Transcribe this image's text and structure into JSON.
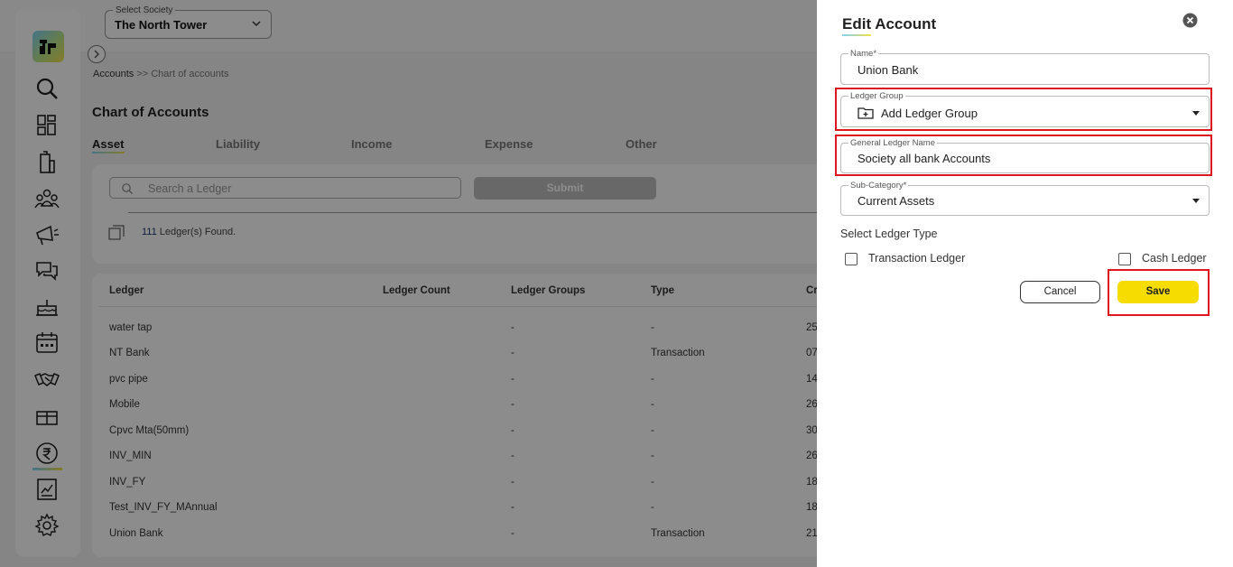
{
  "header": {
    "society_label": "Select Society",
    "society_value": "The North Tower"
  },
  "sidebar": {
    "icons": [
      "search-icon",
      "dashboard-icon",
      "building-icon",
      "people-icon",
      "megaphone-icon",
      "chat-icon",
      "cake-icon",
      "calendar-icon",
      "handshake-icon",
      "gift-icon",
      "rupee-icon",
      "report-icon",
      "gear-icon"
    ],
    "active": "rupee-icon"
  },
  "breadcrumb": {
    "root": "Accounts",
    "separator": ">>",
    "current": "Chart of accounts"
  },
  "page": {
    "title": "Chart of Accounts"
  },
  "tabs": [
    "Asset",
    "Liability",
    "Income",
    "Expense",
    "Other"
  ],
  "filters": {
    "search_placeholder": "Search a Ledger",
    "submit_label": "Submit",
    "found_count": "111",
    "found_suffix": "Ledger(s) Found."
  },
  "table": {
    "columns": [
      "Ledger",
      "Ledger Count",
      "Ledger Groups",
      "Type",
      "Cr"
    ],
    "rows": [
      {
        "ledger": "water tap",
        "count": "",
        "groups": "-",
        "type": "-",
        "cr": "25"
      },
      {
        "ledger": "NT Bank",
        "count": "",
        "groups": "-",
        "type": "Transaction",
        "cr": "07"
      },
      {
        "ledger": "pvc pipe",
        "count": "",
        "groups": "-",
        "type": "-",
        "cr": "14"
      },
      {
        "ledger": "Mobile",
        "count": "",
        "groups": "-",
        "type": "-",
        "cr": "26"
      },
      {
        "ledger": "Cpvc Mta(50mm)",
        "count": "",
        "groups": "-",
        "type": "-",
        "cr": "30"
      },
      {
        "ledger": "INV_MIN",
        "count": "",
        "groups": "-",
        "type": "-",
        "cr": "26"
      },
      {
        "ledger": "INV_FY",
        "count": "",
        "groups": "-",
        "type": "-",
        "cr": "18"
      },
      {
        "ledger": "Test_INV_FY_MAnnual",
        "count": "",
        "groups": "-",
        "type": "-",
        "cr": "18"
      },
      {
        "ledger": "Union Bank",
        "count": "",
        "groups": "-",
        "type": "Transaction",
        "cr": "21"
      }
    ]
  },
  "drawer": {
    "title": "Edit Account",
    "name_label": "Name*",
    "name_value": "Union Bank",
    "ledger_group_label": "Ledger Group",
    "ledger_group_value": "Add Ledger Group",
    "gl_name_label": "General Ledger Name",
    "gl_name_value": "Society all bank Accounts",
    "subcategory_label": "Sub-Category*",
    "subcategory_value": "Current Assets",
    "ledger_type_label": "Select Ledger Type",
    "transaction_ledger_label": "Transaction Ledger",
    "cash_ledger_label": "Cash Ledger",
    "cancel_label": "Cancel",
    "save_label": "Save",
    "highlight_color": "#e0161f",
    "save_color": "#f7dc00"
  }
}
